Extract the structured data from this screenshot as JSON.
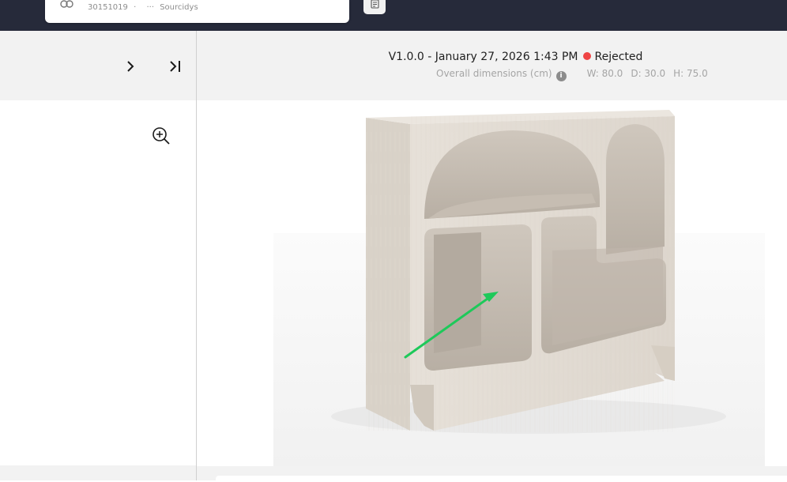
{
  "top_card": {
    "item_code": "30151019",
    "separator": "·",
    "more_icon": "ellipsis-icon",
    "supplier": "Sourcidys",
    "left_icon": "link-icon",
    "right_icon": "document-icon"
  },
  "navigation": {
    "next_icon": "chevron-right-icon",
    "last_icon": "chevron-last-icon",
    "zoom_icon": "zoom-in-icon"
  },
  "version": {
    "label": "V1.0.0 - January 27, 2026 1:43 PM",
    "status": "Rejected",
    "status_color": "#ef4444"
  },
  "dimensions": {
    "label": "Overall dimensions (cm)",
    "width": "W: 80.0",
    "depth": "D: 30.0",
    "height": "H: 75.0"
  },
  "viewer": {
    "image": "travertine-shelf-render",
    "annotation": "green-arrow",
    "annotation_color": "#1ec95a"
  }
}
